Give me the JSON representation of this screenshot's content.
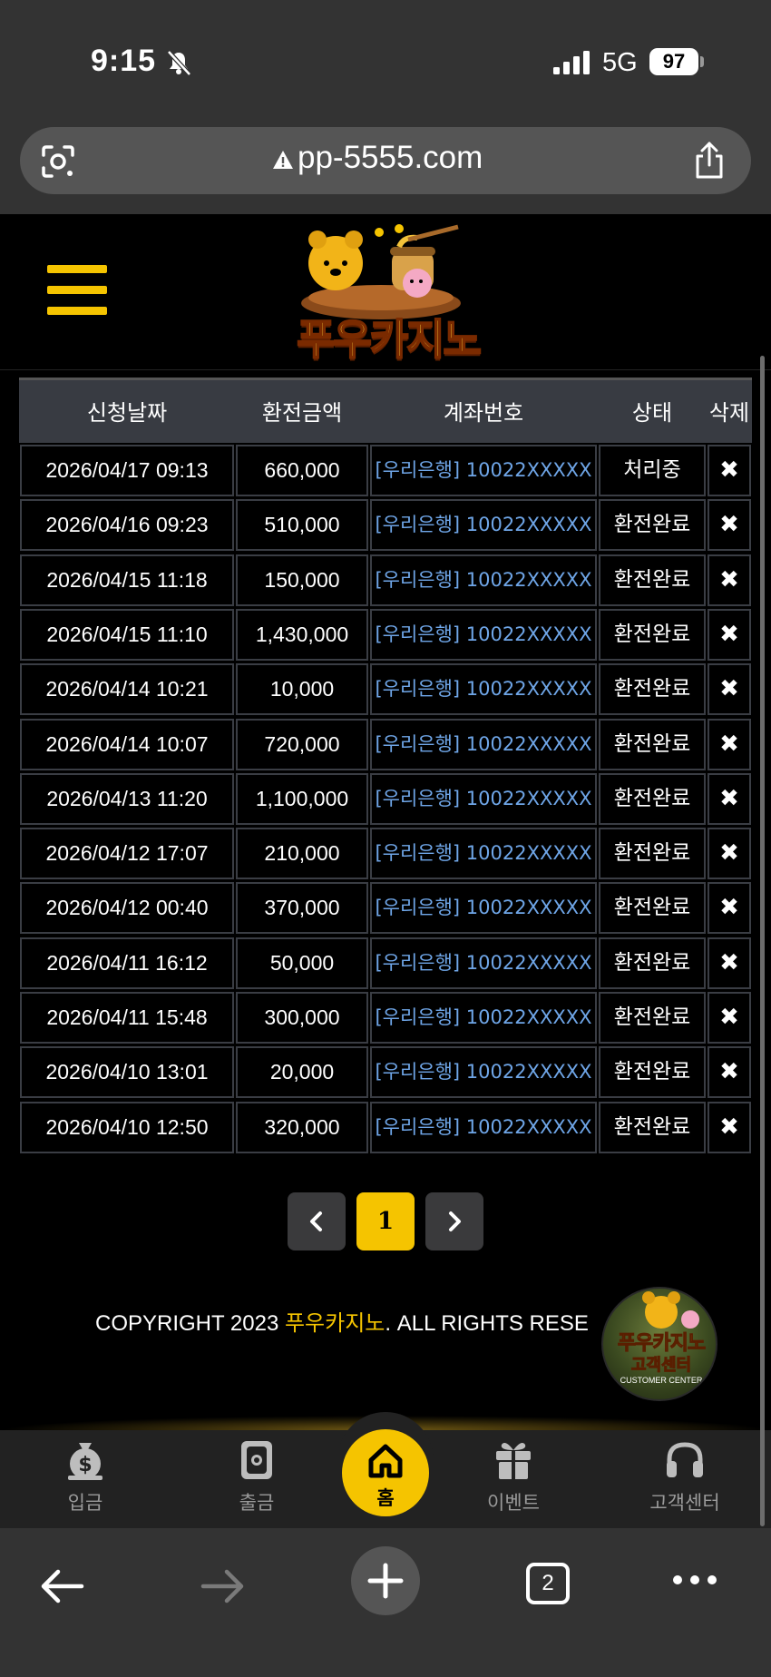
{
  "status_bar": {
    "time": "9:15",
    "network": "5G",
    "battery": "97"
  },
  "browser": {
    "url": "pp-5555.com",
    "tab_count": "2"
  },
  "site": {
    "logo_text": "푸우카지노"
  },
  "table": {
    "headers": [
      "신청날짜",
      "환전금액",
      "계좌번호",
      "상태",
      "삭제"
    ],
    "rows": [
      {
        "date": "2026/04/17 09:13",
        "amount": "660,000",
        "account": "[우리은행] 10022XXXXX",
        "status": "처리중",
        "delete": "✖"
      },
      {
        "date": "2026/04/16 09:23",
        "amount": "510,000",
        "account": "[우리은행] 10022XXXXX",
        "status": "환전완료",
        "delete": "✖"
      },
      {
        "date": "2026/04/15 11:18",
        "amount": "150,000",
        "account": "[우리은행] 10022XXXXX",
        "status": "환전완료",
        "delete": "✖"
      },
      {
        "date": "2026/04/15 11:10",
        "amount": "1,430,000",
        "account": "[우리은행] 10022XXXXX",
        "status": "환전완료",
        "delete": "✖"
      },
      {
        "date": "2026/04/14 10:21",
        "amount": "10,000",
        "account": "[우리은행] 10022XXXXX",
        "status": "환전완료",
        "delete": "✖"
      },
      {
        "date": "2026/04/14 10:07",
        "amount": "720,000",
        "account": "[우리은행] 10022XXXXX",
        "status": "환전완료",
        "delete": "✖"
      },
      {
        "date": "2026/04/13 11:20",
        "amount": "1,100,000",
        "account": "[우리은행] 10022XXXXX",
        "status": "환전완료",
        "delete": "✖"
      },
      {
        "date": "2026/04/12 17:07",
        "amount": "210,000",
        "account": "[우리은행] 10022XXXXX",
        "status": "환전완료",
        "delete": "✖"
      },
      {
        "date": "2026/04/12 00:40",
        "amount": "370,000",
        "account": "[우리은행] 10022XXXXX",
        "status": "환전완료",
        "delete": "✖"
      },
      {
        "date": "2026/04/11 16:12",
        "amount": "50,000",
        "account": "[우리은행] 10022XXXXX",
        "status": "환전완료",
        "delete": "✖"
      },
      {
        "date": "2026/04/11 15:48",
        "amount": "300,000",
        "account": "[우리은행] 10022XXXXX",
        "status": "환전완료",
        "delete": "✖"
      },
      {
        "date": "2026/04/10 13:01",
        "amount": "20,000",
        "account": "[우리은행] 10022XXXXX",
        "status": "환전완료",
        "delete": "✖"
      },
      {
        "date": "2026/04/10 12:50",
        "amount": "320,000",
        "account": "[우리은행] 10022XXXXX",
        "status": "환전완료",
        "delete": "✖"
      }
    ]
  },
  "pagination": {
    "current_page": "1"
  },
  "footer": {
    "copyright_prefix": "COPYRIGHT 2023 ",
    "brand": "푸우카지노",
    "copyright_suffix": ". ALL RIGHTS RESE",
    "cs_badge_line1": "푸우카지노",
    "cs_badge_line2": "고객센터",
    "cs_badge_line3": "CUSTOMER CENTER"
  },
  "app_nav": {
    "deposit": "입금",
    "withdraw": "출금",
    "home": "홈",
    "event": "이벤트",
    "support": "고객센터"
  },
  "colors": {
    "accent": "#f5c400",
    "account_link": "#6fa6e8",
    "header_bg": "#383b42",
    "nav_bg": "#222222"
  },
  "icons": [
    "bell-off-icon",
    "signal-icon",
    "lens-icon",
    "warning-icon",
    "share-icon",
    "hamburger-icon",
    "chevron-left-icon",
    "chevron-right-icon",
    "dollar-bag-icon",
    "wallet-icon",
    "home-icon",
    "gift-icon",
    "headset-icon",
    "back-arrow-icon",
    "forward-arrow-icon",
    "plus-icon",
    "more-icon"
  ]
}
